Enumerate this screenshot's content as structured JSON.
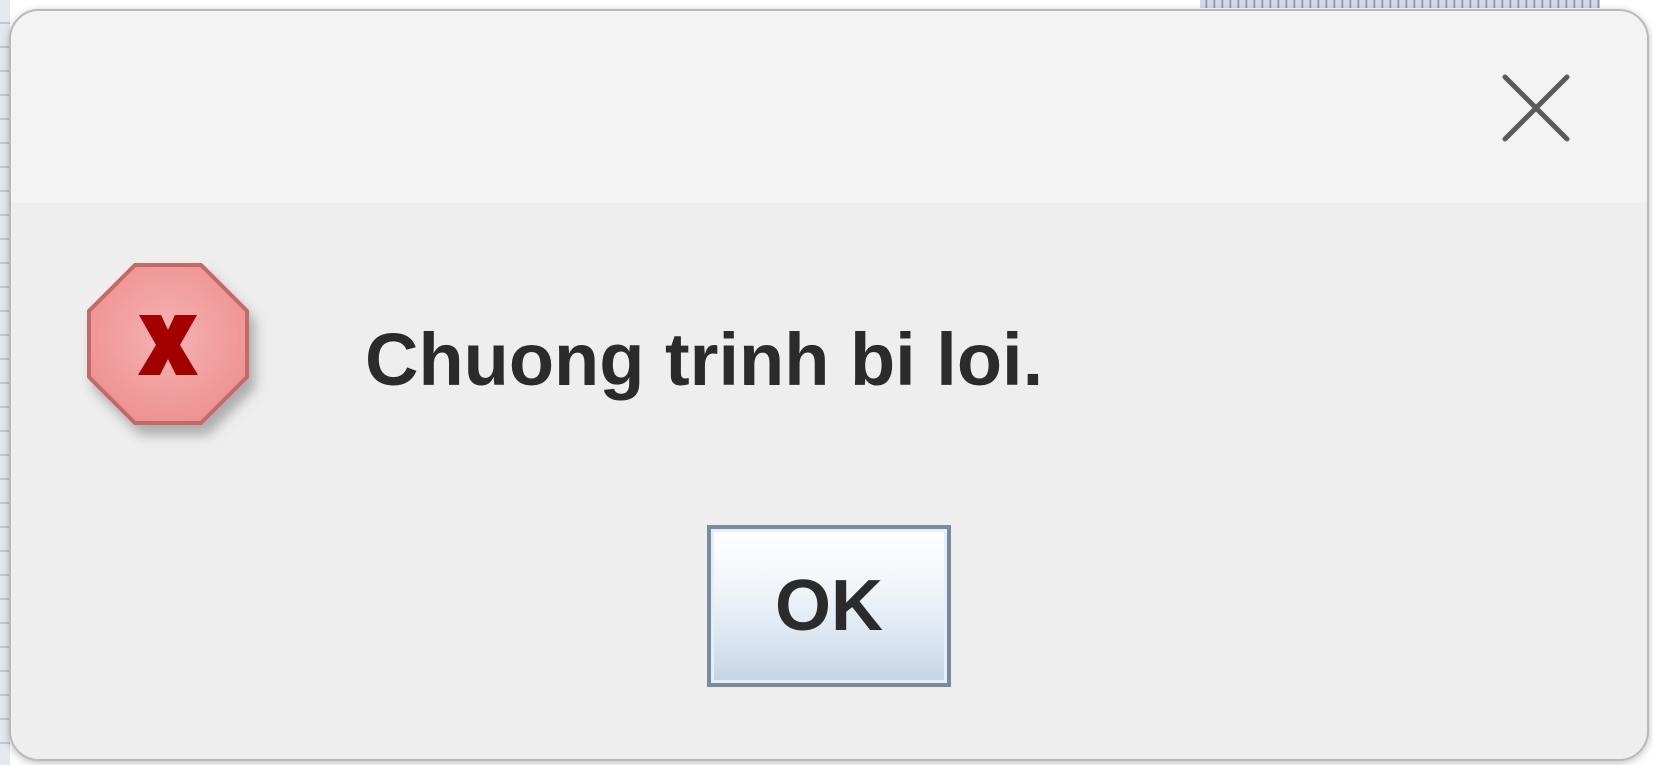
{
  "dialog": {
    "message": "Chuong trinh bi loi.",
    "icon": "error-stop-icon",
    "ok_label": "OK",
    "close_icon": "close-icon"
  },
  "colors": {
    "error_icon_fill": "#ef9a9a",
    "error_icon_border": "#c26a6a",
    "error_icon_x": "#a30000",
    "dialog_background": "#eeeeee",
    "title_bar_background": "#f3f3f3",
    "button_border": "#7a8a9f"
  }
}
